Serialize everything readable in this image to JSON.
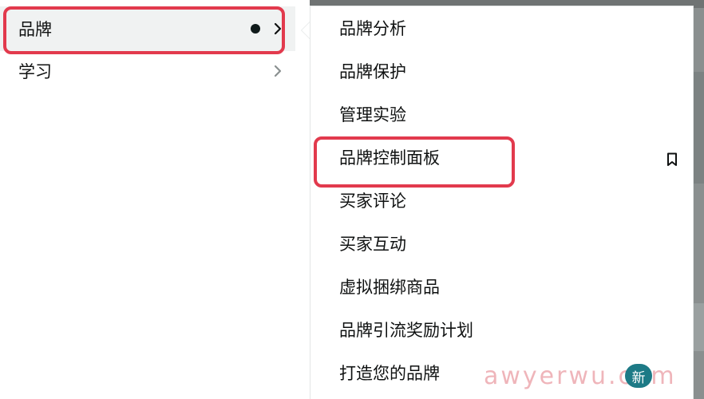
{
  "left_menu": {
    "items": [
      {
        "label": "品牌"
      },
      {
        "label": "学习"
      }
    ]
  },
  "submenu": {
    "items": [
      {
        "label": "品牌分析"
      },
      {
        "label": "品牌保护"
      },
      {
        "label": "管理实验"
      },
      {
        "label": "品牌控制面板"
      },
      {
        "label": "买家评论"
      },
      {
        "label": "买家互动"
      },
      {
        "label": "虚拟捆绑商品"
      },
      {
        "label": "品牌引流奖励计划"
      },
      {
        "label": "打造您的品牌"
      }
    ],
    "new_badge": "新"
  },
  "watermark": "awyerwu.com",
  "colors": {
    "highlight_border": "#e23a4d",
    "active_bg": "#f0f2f2",
    "badge_bg": "#1d7a86"
  }
}
